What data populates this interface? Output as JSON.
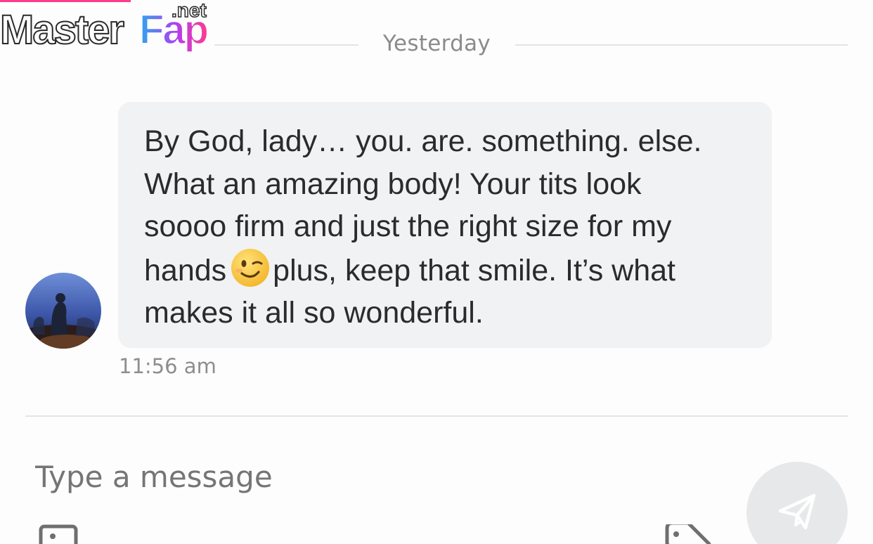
{
  "watermark": {
    "text_part1": "Master",
    "text_part2": "Fap",
    "suffix": ".net"
  },
  "chat": {
    "date_label": "Yesterday",
    "message": {
      "lines": [
        "By God, lady… you. are. something. else.",
        "What an amazing body! Your tits look",
        "soooo firm and just the right size for my",
        "hands",
        "plus, keep that smile. It’s what",
        "makes it all so wonderful."
      ],
      "emoji_icon": "winking-face-icon",
      "time": "11:56 am"
    }
  },
  "composer": {
    "placeholder": "Type a message",
    "send_icon": "paper-plane-icon",
    "attach_icon": "image-icon",
    "tag_icon": "price-tag-icon"
  },
  "colors": {
    "bubble": "#f1f2f3",
    "divider": "#e4e4e4",
    "muted_text": "#8b8b8b",
    "placeholder": "#b9b9b9",
    "send_button": "#e7e8e9",
    "watermark_blue": "#29a8f0",
    "watermark_purple": "#b43cf0",
    "watermark_pink": "#ff3c8e"
  }
}
